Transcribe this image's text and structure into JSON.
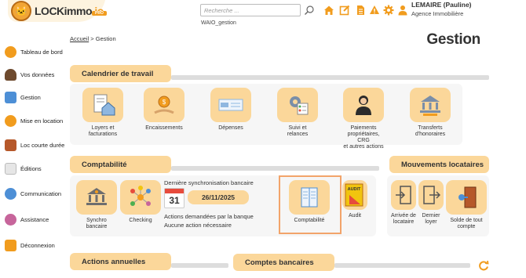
{
  "header": {
    "logo_main": "LOCKimmo",
    "logo_io": ".io",
    "logo_badge": "PRO",
    "search_placeholder": "Recherche ...",
    "account_id": "WAIO_gestion",
    "user_name": "LEMAIRE (Pauline)",
    "agency": "Agence Immobilière",
    "toolbar_icons": [
      "home-icon",
      "edit-icon",
      "document-icon",
      "alert-icon",
      "gear-icon",
      "user-icon"
    ]
  },
  "sidebar": {
    "items": [
      {
        "label": "Tableau de bord",
        "icon": "dashboard-icon"
      },
      {
        "label": "Vos données",
        "icon": "person-icon"
      },
      {
        "label": "Gestion",
        "icon": "folder-icon"
      },
      {
        "label": "Mise en location",
        "icon": "megaphone-icon"
      },
      {
        "label": "Loc courte durée",
        "icon": "suitcase-icon"
      },
      {
        "label": "Éditions",
        "icon": "document-icon"
      },
      {
        "label": "Communication",
        "icon": "chat-icon"
      },
      {
        "label": "Assistance",
        "icon": "support-icon"
      },
      {
        "label": "Déconnexion",
        "icon": "logout-icon"
      }
    ]
  },
  "breadcrumb": {
    "home": "Accueil",
    "separator": ">",
    "current": "Gestion"
  },
  "page_title": "Gestion",
  "calendrier": {
    "title": "Calendrier de travail",
    "tiles": [
      {
        "label": "Loyers et\nfacturations",
        "icon": "house-invoice-icon"
      },
      {
        "label": "Encaissements",
        "icon": "coins-icon"
      },
      {
        "label": "Dépenses",
        "icon": "bills-icon"
      },
      {
        "label": "Suivi et\nrelances",
        "icon": "gear-checklist-icon"
      },
      {
        "label": "Paiements\npropriétaires, CRG\net autres actions",
        "icon": "owner-icon"
      },
      {
        "label": "Transferts\nd'honoraires",
        "icon": "bank-transfer-icon"
      }
    ]
  },
  "comptabilite": {
    "title": "Comptabilité",
    "tiles": [
      {
        "label": "Synchro\nbancaire",
        "icon": "bank-sync-icon"
      },
      {
        "label": "Checking",
        "icon": "network-icon"
      },
      {
        "label": "Comptabilité",
        "icon": "ledger-icon"
      },
      {
        "label": "Audit",
        "icon": "audit-icon"
      }
    ],
    "sync_title": "Dernière synchronisation bancaire",
    "calendar_day": "31",
    "sync_date": "26/11/2025",
    "actions_title": "Actions demandées par la banque",
    "actions_value": "Aucune action nécessaire"
  },
  "mouvements": {
    "title": "Mouvements locataires",
    "tiles": [
      {
        "label": "Arrivée de\nlocataire",
        "icon": "enter-door-icon"
      },
      {
        "label": "Dernier\nloyer",
        "icon": "exit-door-icon"
      },
      {
        "label": "Solde de tout\ncompte",
        "icon": "key-door-icon"
      }
    ]
  },
  "annuelles": {
    "title": "Actions annuelles"
  },
  "comptes": {
    "title": "Comptes bancaires"
  },
  "colors": {
    "accent": "#fbd79a",
    "brand": "#f19c1e",
    "highlight": "#f2a46a"
  }
}
